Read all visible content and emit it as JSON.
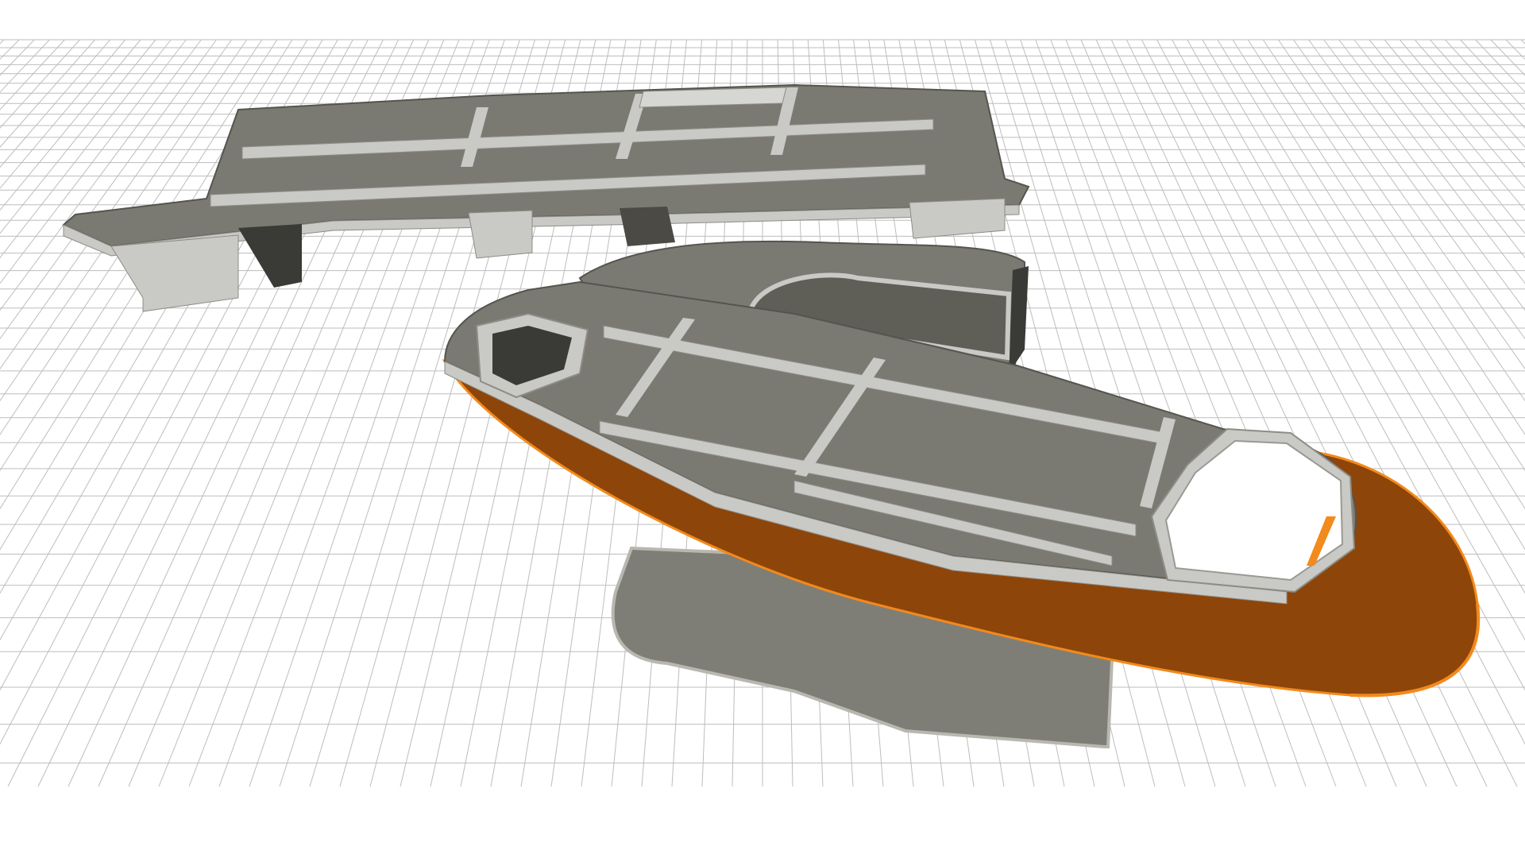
{
  "scene": {
    "grid_on": true,
    "colors": {
      "background": "#ffffff",
      "grid_line": "#bdbdbd",
      "concrete_top": "#7b7a72",
      "concrete_dark": "#5f5e57",
      "concrete_side": "#c9c9c5",
      "concrete_shadow": "#3a3a36",
      "hull_fill": "#8e4509",
      "hull_edge": "#f28a1c",
      "projection_shadow": "#7f7e76"
    },
    "objects": [
      {
        "name": "rear-deck-structure",
        "kind": "concrete structure"
      },
      {
        "name": "hull-structure",
        "kind": "concrete structure"
      },
      {
        "name": "hull-bottom",
        "kind": "orange surface"
      }
    ]
  }
}
